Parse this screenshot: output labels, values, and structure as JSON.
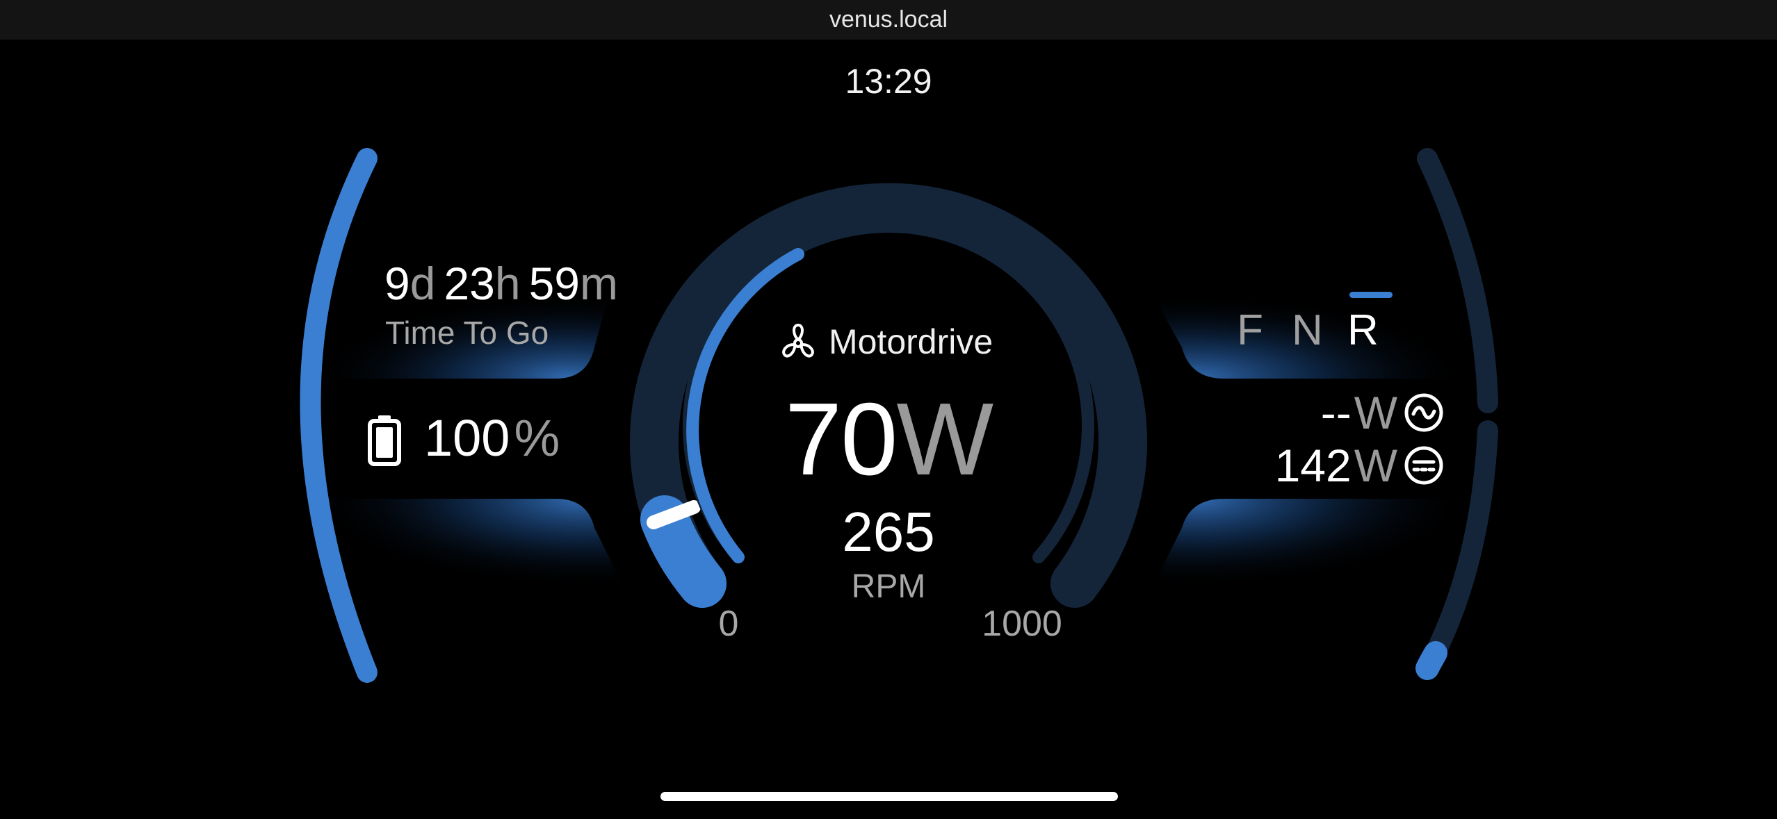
{
  "browser": {
    "url": "venus.local"
  },
  "status": {
    "time": "13:29"
  },
  "time_to_go": {
    "days": "9",
    "days_unit": "d",
    "hours": "23",
    "hours_unit": "h",
    "minutes": "59",
    "minutes_unit": "m",
    "label": "Time To Go"
  },
  "battery": {
    "soc_value": "100",
    "soc_unit": "%",
    "icon": "battery-icon",
    "level": 1.0
  },
  "motordrive": {
    "title": "Motordrive",
    "icon": "fan-icon",
    "power_value": "70",
    "power_unit": "W",
    "rpm_value": "265",
    "rpm_label": "RPM",
    "scale_min": "0",
    "scale_max": "1000",
    "rpm_fraction": 0.265
  },
  "gears": {
    "items": [
      "F",
      "N",
      "R"
    ],
    "active": "R"
  },
  "power_sources": {
    "ac": {
      "value": "--",
      "unit": "W",
      "icon": "ac-icon"
    },
    "dc": {
      "value": "142",
      "unit": "W",
      "icon": "dc-icon"
    }
  },
  "colors": {
    "accent": "#3b7fd3",
    "track": "#14253a",
    "background": "#000000",
    "muted_text": "#9a9a9a"
  }
}
